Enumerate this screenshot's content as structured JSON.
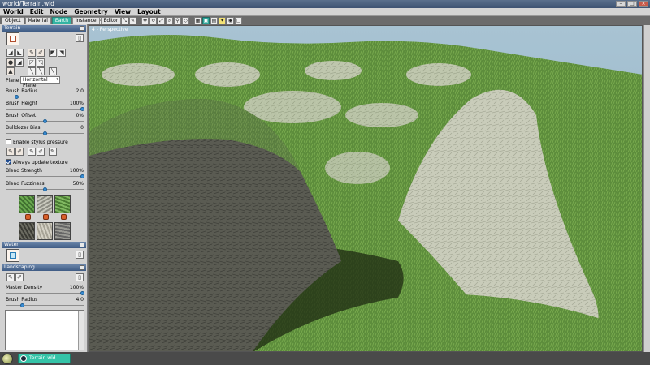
{
  "window": {
    "title": "world/Terrain.wld"
  },
  "menubar": {
    "items": [
      "World",
      "Edit",
      "Node",
      "Geometry",
      "View",
      "Layout"
    ]
  },
  "tabs": [
    {
      "label": "Object"
    },
    {
      "label": "Material"
    },
    {
      "label": "Earth",
      "active": true
    },
    {
      "label": "Instance"
    },
    {
      "label": "Editor"
    }
  ],
  "terrain_section": {
    "header": "Terrain",
    "plane_label": "Plane",
    "plane_value": "Horizontal Plane",
    "brush_radius": {
      "label": "Brush Radius",
      "value": "2.0",
      "level": 0.12
    },
    "brush_height": {
      "label": "Brush Height",
      "value": "100%",
      "level": 1.0
    },
    "brush_offset": {
      "label": "Brush Offset",
      "value": "0%",
      "level": 0.5
    },
    "bulldozer_bias": {
      "label": "Bulldozer Bias",
      "value": "0",
      "level": 0.5
    },
    "stylus_label": "Enable stylus pressure",
    "stylus_checked": false,
    "always_update_label": "Always update texture",
    "always_update_checked": true,
    "blend_strength": {
      "label": "Blend Strength",
      "value": "100%",
      "level": 1.0
    },
    "blend_fuzziness": {
      "label": "Blend Fuzziness",
      "value": "50%",
      "level": 0.5
    }
  },
  "water_section": {
    "header": "Water"
  },
  "landscaping_section": {
    "header": "Landscaping",
    "master_density": {
      "label": "Master Density",
      "value": "100%",
      "level": 1.0
    },
    "brush_radius": {
      "label": "Brush Radius",
      "value": "4.0",
      "level": 0.2
    }
  },
  "viewport": {
    "label": "4 - Perspective"
  },
  "taskbar": {
    "item_label": "Terrain.wld"
  },
  "colors": {
    "accent": "#33b4a3",
    "title_blue": "#3f5c85",
    "slider_knob": "#3a8fd8"
  }
}
